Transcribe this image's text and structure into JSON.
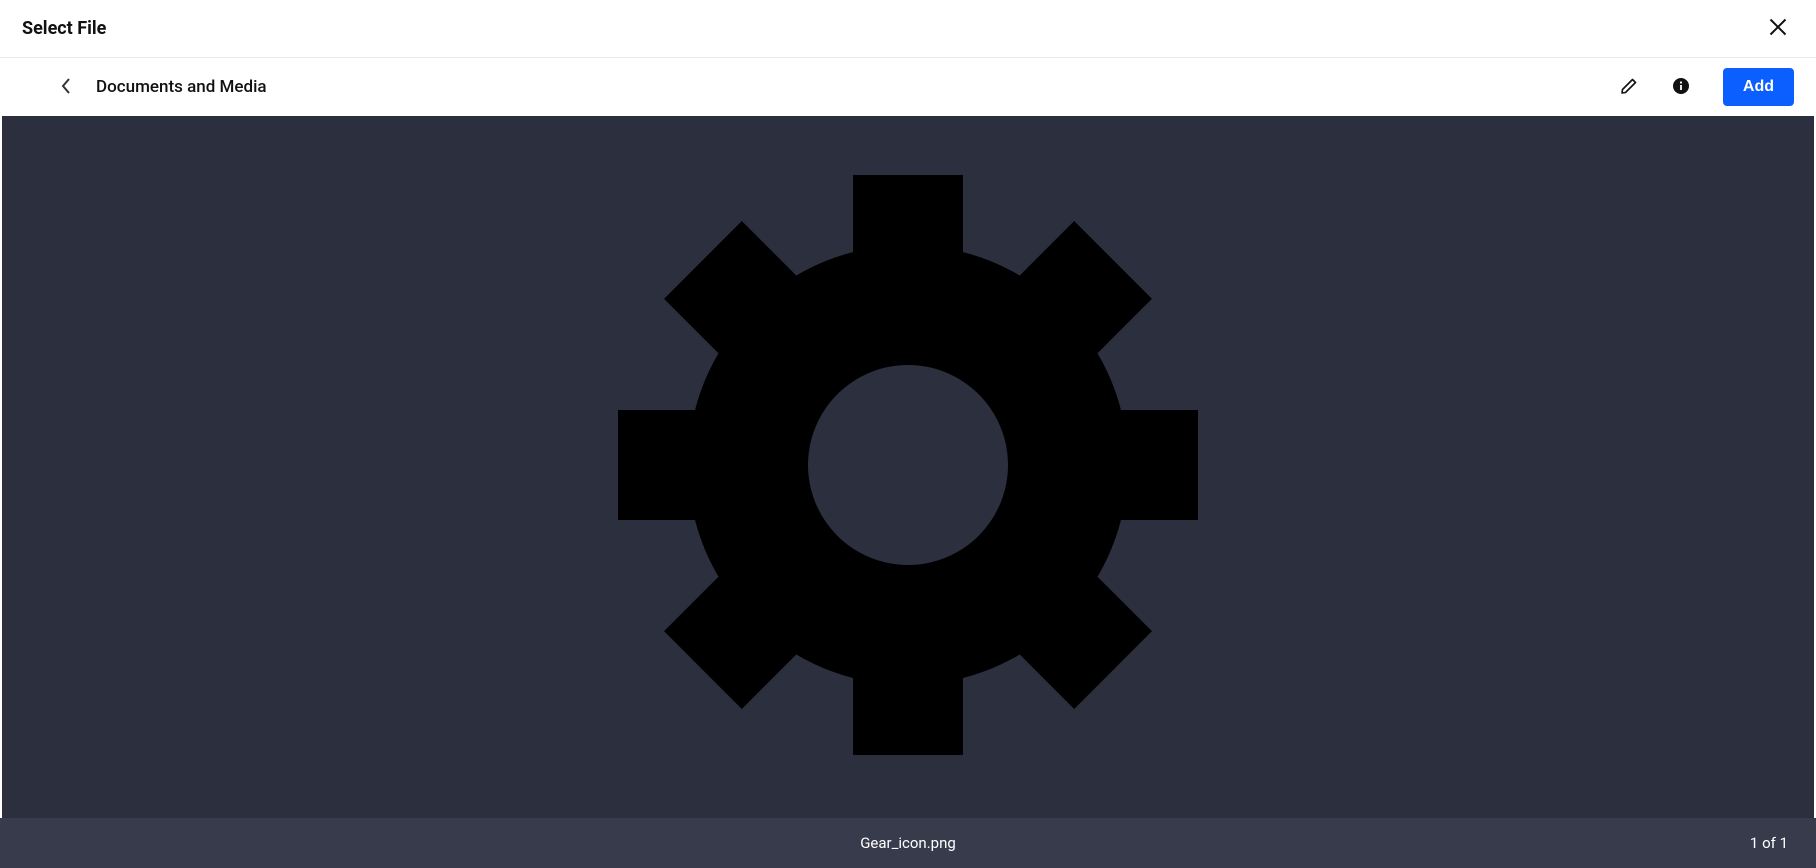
{
  "header": {
    "title": "Select File"
  },
  "toolbar": {
    "breadcrumb": "Documents and Media",
    "add_label": "Add"
  },
  "preview": {
    "filename": "Gear_icon.png",
    "pagination": "1 of 1"
  }
}
